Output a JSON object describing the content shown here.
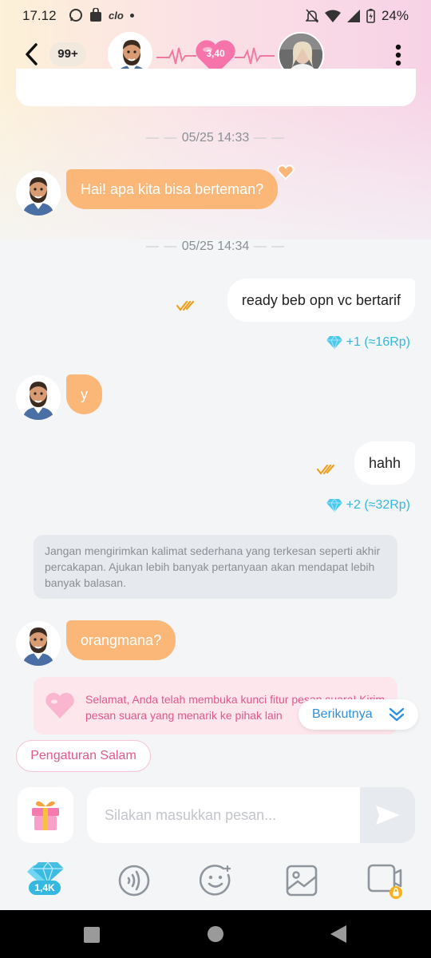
{
  "status_bar": {
    "time": "17.12",
    "carrier_text": "clo",
    "battery": "24%"
  },
  "header": {
    "unread_count": "99+",
    "intimacy_score": "3,40"
  },
  "chat": {
    "timestamps": [
      "05/25 14:33",
      "05/25 14:34"
    ],
    "messages": [
      {
        "direction": "in",
        "text": "Hai! apa kita bisa berteman?"
      },
      {
        "direction": "out",
        "text": "ready beb opn vc bertarif",
        "reward": "+1 (≈16Rp)"
      },
      {
        "direction": "in",
        "text": "y"
      },
      {
        "direction": "out",
        "text": "hahh",
        "reward": "+2 (≈32Rp)"
      },
      {
        "direction": "in",
        "text": "orangmana?"
      }
    ],
    "tip": "Jangan mengirimkan kalimat sederhana yang terkesan seperti akhir percakapan. Ajukan lebih banyak pertanyaan akan mendapat lebih banyak balasan.",
    "unlock_notice": "Selamat, Anda telah membuka kunci fitur pesan suara! Kirim pesan suara yang menarik ke pihak lain",
    "next_label": "Berikutnya",
    "greeting_settings_label": "Pengaturan Salam"
  },
  "composer": {
    "placeholder": "Silakan masukkan pesan..."
  },
  "toolbar": {
    "diamond_balance": "1,4K",
    "icons": [
      "diamond-icon",
      "voice-icon",
      "emoji-icon",
      "image-icon",
      "video-call-icon"
    ]
  },
  "colors": {
    "incoming_bubble": "#fbb778",
    "outgoing_bubble": "#ffffff",
    "reward_text": "#35b8e0",
    "unlock_text": "#e2588b",
    "next_text": "#2f8fe0"
  }
}
